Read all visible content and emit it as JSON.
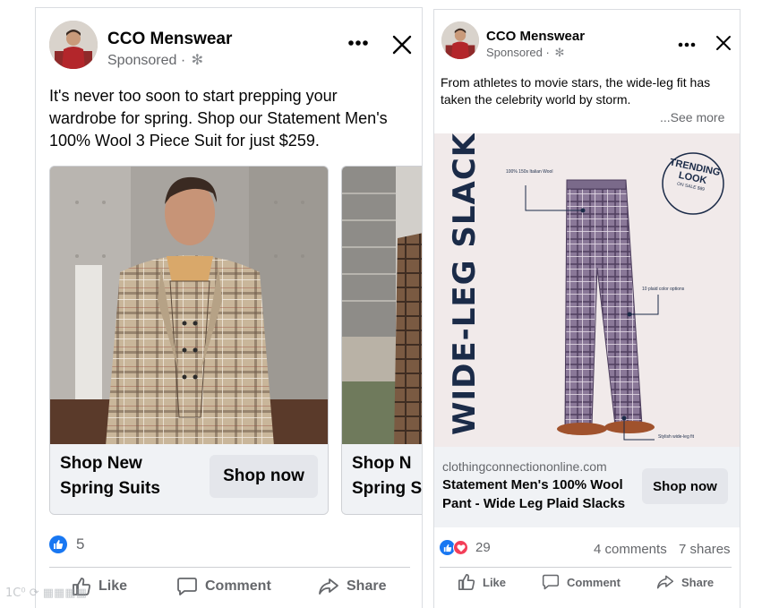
{
  "post1": {
    "page_name": "CCO Menswear",
    "sponsored": "Sponsored",
    "body_text": "It's never too soon to start prepping your wardrobe for spring. Shop our Statement Men's 100% Wool 3 Piece Suit for just $259.",
    "carousel": [
      {
        "title_line1": "Shop New",
        "title_line2": "Spring Suits",
        "button": "Shop now"
      },
      {
        "title_line1": "Shop N",
        "title_line2": "Spring S"
      }
    ],
    "reaction_count": "5",
    "actions": {
      "like": "Like",
      "comment": "Comment",
      "share": "Share"
    }
  },
  "post2": {
    "page_name": "CCO Menswear",
    "sponsored": "Sponsored",
    "body_text": "From athletes to movie stars, the wide-leg fit has taken the celebrity world by storm.",
    "see_more": "...See more",
    "ad_image": {
      "headline": "WIDE-LEG SLACKS",
      "badge_line1": "TRENDING",
      "badge_line2": "LOOK",
      "badge_line3": "ON SALE $89",
      "annotation_1": "100% 150s Italian Wool",
      "annotation_2": "10 plaid color options",
      "annotation_3": "Stylish wide-leg fit"
    },
    "domain": "clothingconnectiononline.com",
    "title_line1": "Statement Men's 100% Wool",
    "title_line2": "Pant - Wide Leg Plaid Slacks",
    "button": "Shop now",
    "reaction_count": "29",
    "comments": "4 comments",
    "shares": "7 shares",
    "actions": {
      "like": "Like",
      "comment": "Comment",
      "share": "Share"
    }
  },
  "colors": {
    "like_blue": "#1877f2",
    "love_red": "#f33e58",
    "gray_text": "#65676b",
    "footer_gray": "#f0f2f5",
    "ad_navy": "#1b2b48"
  }
}
